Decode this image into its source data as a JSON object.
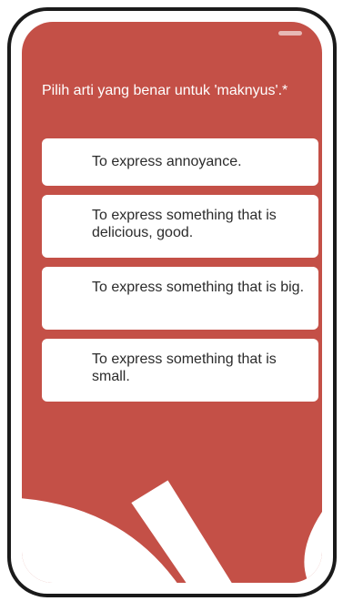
{
  "question": {
    "text": "Pilih arti yang benar untuk 'maknyus'.*"
  },
  "options": [
    {
      "label": "To express annoyance."
    },
    {
      "label": "To express something that is delicious, good."
    },
    {
      "label": "To express something that is big."
    },
    {
      "label": "To express something that is small."
    }
  ],
  "colors": {
    "background": "#c45047",
    "card": "#ffffff",
    "text_on_card": "#2b2b2b",
    "frame": "#1a1a1a"
  }
}
